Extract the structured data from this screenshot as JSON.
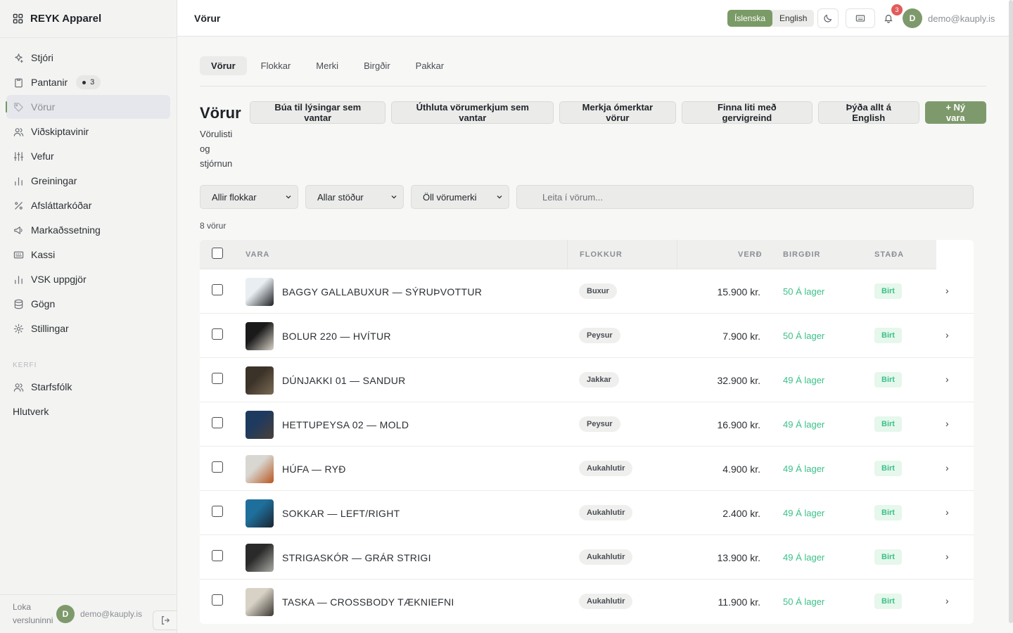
{
  "brand": {
    "name": "REYK Apparel"
  },
  "sidebar": {
    "items": [
      {
        "label": "Stjóri",
        "icon": "sparkle-icon"
      },
      {
        "label": "Pantanir",
        "icon": "clipboard-icon",
        "badge": "3"
      },
      {
        "label": "Vörur",
        "icon": "tag-icon",
        "active": true
      },
      {
        "label": "Viðskiptavinir",
        "icon": "users-icon"
      },
      {
        "label": "Vefur",
        "icon": "sliders-icon"
      },
      {
        "label": "Greiningar",
        "icon": "bar-chart-icon"
      },
      {
        "label": "Afsláttarkóðar",
        "icon": "percent-icon"
      },
      {
        "label": "Markaðssetning",
        "icon": "megaphone-icon"
      },
      {
        "label": "Kassi",
        "icon": "keyboard-icon"
      },
      {
        "label": "VSK uppgjör",
        "icon": "bar-chart-icon"
      },
      {
        "label": "Gögn",
        "icon": "database-icon"
      },
      {
        "label": "Stillingar",
        "icon": "gear-icon"
      }
    ],
    "section_label": "KERFI",
    "system_items": [
      {
        "label": "Starfsfólk",
        "icon": "users-icon"
      }
    ],
    "plain_item": "Hlutverk",
    "footer": {
      "logout_text": "Loka versluninni",
      "avatar": "D",
      "email": "demo@kauply.is"
    }
  },
  "topbar": {
    "title": "Vörur",
    "lang_active": "Íslenska",
    "lang_other": "English",
    "notifications": "3",
    "avatar": "D",
    "email": "demo@kauply.is"
  },
  "tabs": [
    "Vörur",
    "Flokkar",
    "Merki",
    "Birgðir",
    "Pakkar"
  ],
  "page": {
    "title": "Vörur",
    "subtitle": "Vörulisti og stjórnun",
    "actions": [
      "Búa til lýsingar sem vantar",
      "Úthluta vörumerkjum sem vantar",
      "Merkja ómerktar vörur",
      "Finna liti með gervigreind",
      "Þýða allt á English"
    ],
    "primary_action": "+ Ný vara"
  },
  "filters": {
    "category": "Allir flokkar",
    "status": "Allar stöður",
    "brand": "Öll vörumerki",
    "search_placeholder": "Leita í vörum..."
  },
  "count_label": "8 vörur",
  "table": {
    "headers": {
      "product": "VARA",
      "category": "FLOKKUR",
      "price": "VERÐ",
      "stock": "BIRGÐIR",
      "status": "STAÐA"
    },
    "rows": [
      {
        "name": "BAGGY GALLABUXUR — SÝRUÞVOTTUR",
        "category": "Buxur",
        "price": "15.900 kr.",
        "stock": "50 Á lager",
        "status": "Birt",
        "thumb": [
          "#e8eef2",
          "#1d1f22"
        ]
      },
      {
        "name": "BOLUR 220 — HVÍTUR",
        "category": "Peysur",
        "price": "7.900 kr.",
        "stock": "50 Á lager",
        "status": "Birt",
        "thumb": [
          "#1a1a1a",
          "#d9d3c8"
        ]
      },
      {
        "name": "DÚNJAKKI 01 — SANDUR",
        "category": "Jakkar",
        "price": "32.900 kr.",
        "stock": "49 Á lager",
        "status": "Birt",
        "thumb": [
          "#3b3328",
          "#7b6a55"
        ]
      },
      {
        "name": "HETTUPEYSA 02 — MOLD",
        "category": "Peysur",
        "price": "16.900 kr.",
        "stock": "49 Á lager",
        "status": "Birt",
        "thumb": [
          "#1e3a5f",
          "#4a4038"
        ]
      },
      {
        "name": "HÚFA — RYÐ",
        "category": "Aukahlutir",
        "price": "4.900 kr.",
        "stock": "49 Á lager",
        "status": "Birt",
        "thumb": [
          "#d9d7d2",
          "#b8561f"
        ]
      },
      {
        "name": "SOKKAR — LEFT/RIGHT",
        "category": "Aukahlutir",
        "price": "2.400 kr.",
        "stock": "49 Á lager",
        "status": "Birt",
        "thumb": [
          "#1f6f9c",
          "#1a2430"
        ]
      },
      {
        "name": "STRIGASKÓR — GRÁR STRIGI",
        "category": "Aukahlutir",
        "price": "13.900 kr.",
        "stock": "49 Á lager",
        "status": "Birt",
        "thumb": [
          "#2a2a2a",
          "#a9a9a4"
        ]
      },
      {
        "name": "TASKA — CROSSBODY TÆKNIEFNI",
        "category": "Aukahlutir",
        "price": "11.900 kr.",
        "stock": "50 Á lager",
        "status": "Birt",
        "thumb": [
          "#d8d2c6",
          "#3a3631"
        ]
      }
    ]
  }
}
